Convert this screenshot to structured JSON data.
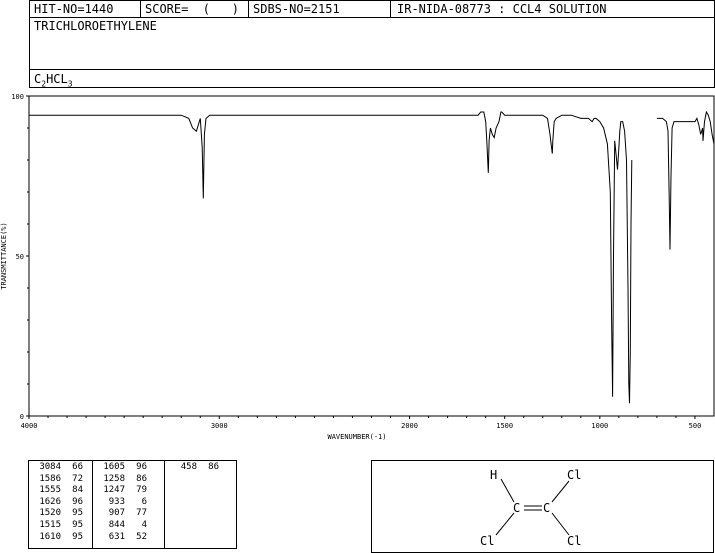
{
  "header": {
    "hit_no": "HIT-NO=1440",
    "score": "SCORE=  (   )",
    "sdbs_no": "SDBS-NO=2151",
    "ir_info": "IR-NIDA-08773 : CCL4 SOLUTION",
    "compound_name": "TRICHLOROETHYLENE",
    "formula_parts": [
      "C",
      "2",
      "HCL",
      "3"
    ]
  },
  "chart_data": {
    "type": "line",
    "xlabel": "WAVENUMBER(-1)",
    "ylabel": "TRANSMITTANCE(%)",
    "xlim": [
      4000,
      400
    ],
    "ylim": [
      0,
      100
    ],
    "xticks": [
      4000,
      3000,
      2000,
      1500,
      1000,
      500
    ],
    "yticks": [
      0,
      50,
      100
    ],
    "series": [
      {
        "x": [
          4000,
          3400,
          3200,
          3160,
          3140,
          3120,
          3100,
          3090,
          3084,
          3078,
          3070,
          3050,
          3000,
          2800,
          2500,
          2200,
          1900,
          1700,
          1640,
          1626,
          1615,
          1610,
          1600,
          1594,
          1586,
          1582,
          1575,
          1565,
          1555,
          1545,
          1530,
          1520,
          1515,
          1500,
          1450,
          1400,
          1350,
          1300,
          1275,
          1262,
          1258,
          1250,
          1247,
          1240,
          1230,
          1200,
          1150,
          1100,
          1060,
          1040,
          1030,
          1020,
          1000,
          980,
          960,
          945,
          938,
          933,
          928,
          922,
          915,
          907,
          900,
          895,
          890,
          880,
          870,
          860,
          852,
          848,
          844,
          840,
          836,
          832
        ],
        "y": [
          94,
          94,
          94,
          93,
          90,
          89,
          93,
          84,
          68,
          88,
          93,
          94,
          94,
          94,
          94,
          94,
          94,
          94,
          94,
          95,
          95,
          95,
          92,
          86,
          76,
          86,
          90,
          88,
          87,
          90,
          92,
          95,
          95,
          94,
          94,
          94,
          94,
          94,
          93,
          88,
          86,
          82,
          86,
          92,
          93,
          94,
          94,
          93,
          93,
          92,
          93,
          93,
          92,
          90,
          85,
          70,
          30,
          6,
          50,
          86,
          82,
          77,
          84,
          89,
          92,
          92,
          89,
          80,
          40,
          10,
          4,
          20,
          60,
          80
        ]
      },
      {
        "x": [
          700,
          670,
          650,
          642,
          636,
          631,
          626,
          620,
          610,
          600,
          570,
          520,
          500,
          490,
          480,
          470,
          460,
          458,
          450,
          440,
          430,
          420,
          410,
          400
        ],
        "y": [
          93,
          93,
          92,
          89,
          70,
          52,
          75,
          90,
          92,
          92,
          92,
          92,
          92,
          93,
          91,
          88,
          90,
          86,
          92,
          95,
          94,
          92,
          88,
          85
        ]
      }
    ],
    "peaks": [
      {
        "wavenumber": 3084,
        "transmittance": 66
      },
      {
        "wavenumber": 1586,
        "transmittance": 72
      },
      {
        "wavenumber": 1555,
        "transmittance": 84
      },
      {
        "wavenumber": 1626,
        "transmittance": 96
      },
      {
        "wavenumber": 1520,
        "transmittance": 95
      },
      {
        "wavenumber": 1515,
        "transmittance": 95
      },
      {
        "wavenumber": 1610,
        "transmittance": 95
      },
      {
        "wavenumber": 1605,
        "transmittance": 96
      },
      {
        "wavenumber": 1258,
        "transmittance": 86
      },
      {
        "wavenumber": 1247,
        "transmittance": 79
      },
      {
        "wavenumber": 933,
        "transmittance": 6
      },
      {
        "wavenumber": 907,
        "transmittance": 77
      },
      {
        "wavenumber": 844,
        "transmittance": 4
      },
      {
        "wavenumber": 631,
        "transmittance": 52
      },
      {
        "wavenumber": 458,
        "transmittance": 86
      }
    ]
  },
  "structure": {
    "atoms": [
      "H",
      "C",
      "C",
      "Cl",
      "Cl",
      "Cl"
    ]
  }
}
